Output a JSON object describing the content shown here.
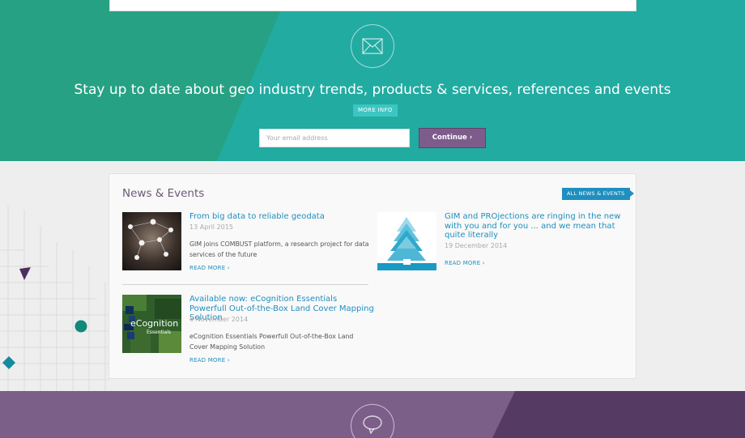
{
  "newsletter": {
    "headline": "Stay up to date about geo industry trends, products & services, references and events",
    "more_info_label": "MORE INFO",
    "email_placeholder": "Your email address",
    "continue_label": "Continue  ›",
    "icon": "envelope-icon",
    "colors": {
      "left": "#27a184",
      "right": "#22aba1",
      "badge": "#3cc6c3",
      "button": "#7d5c8c"
    }
  },
  "news": {
    "title": "News & Events",
    "all_news_label": "ALL NEWS & EVENTS",
    "items": [
      {
        "title": "From big data to reliable geodata",
        "date": "13 April 2015",
        "text": "GIM joins COMBUST platform, a research project for data services of the future",
        "read_more": "READ MORE ›",
        "thumb": "network-photo"
      },
      {
        "title": "GIM and PROjections are ringing in the new with you and for you ... and we mean that quite literally",
        "date": "19 December 2014",
        "text": "",
        "read_more": "READ MORE ›",
        "thumb": "christmas-tree-graphic"
      },
      {
        "title": "Available now: eCognition Essentials Powerfull Out-of-the-Box Land Cover Mapping Solution",
        "date": "6 November 2014",
        "text": "eCognition Essentials Powerfull Out-of-the-Box Land Cover Mapping Solution",
        "read_more": "READ MORE ›",
        "thumb": "ecognition-essentials-logo",
        "thumb_logo_text": "eCognition",
        "thumb_logo_sub": "Essentials"
      }
    ],
    "colors": {
      "title": "#6a5a78",
      "link": "#1f8fbf"
    }
  },
  "bottom": {
    "icon": "speech-bubble-icon",
    "colors": {
      "left": "#7b5f89",
      "right": "#553a63"
    }
  }
}
